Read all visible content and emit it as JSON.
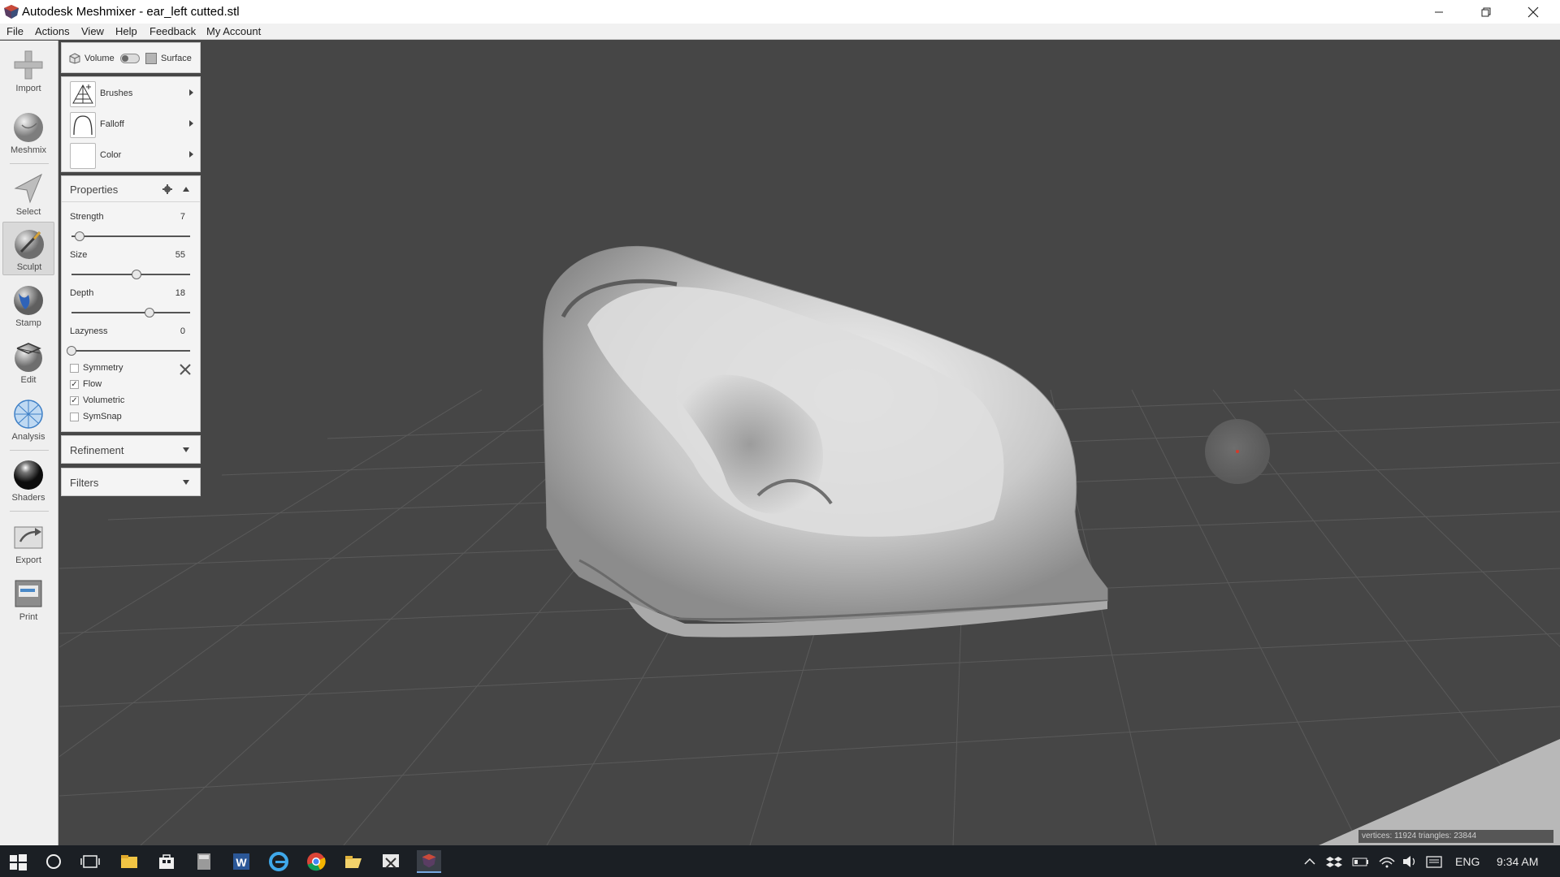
{
  "window": {
    "title": "Autodesk Meshmixer - ear_left cutted.stl"
  },
  "menu": [
    "File",
    "Actions",
    "View",
    "Help",
    "Feedback",
    "My Account"
  ],
  "tools": [
    {
      "label": "Import",
      "icon": "plus-icon"
    },
    {
      "label": "Meshmix",
      "icon": "meshmix-icon"
    },
    {
      "label": "Select",
      "icon": "select-arrow-icon"
    },
    {
      "label": "Sculpt",
      "icon": "sculpt-brush-icon",
      "active": true
    },
    {
      "label": "Stamp",
      "icon": "stamp-icon"
    },
    {
      "label": "Edit",
      "icon": "edit-icon"
    },
    {
      "label": "Analysis",
      "icon": "analysis-icon"
    },
    {
      "label": "Shaders",
      "icon": "shader-sphere-icon"
    },
    {
      "label": "Export",
      "icon": "export-icon"
    },
    {
      "label": "Print",
      "icon": "printer-icon"
    }
  ],
  "mode": {
    "volume_label": "Volume",
    "surface_label": "Surface"
  },
  "brush_panel": {
    "brushes_label": "Brushes",
    "falloff_label": "Falloff",
    "color_label": "Color"
  },
  "properties": {
    "title": "Properties",
    "strength": {
      "label": "Strength",
      "value": "7",
      "fraction": 0.07
    },
    "size": {
      "label": "Size",
      "value": "55",
      "fraction": 0.55
    },
    "depth": {
      "label": "Depth",
      "value": "18",
      "fraction": 0.66
    },
    "lazyness": {
      "label": "Lazyness",
      "value": "0",
      "fraction": 0.0
    },
    "symmetry": {
      "label": "Symmetry",
      "checked": false
    },
    "flow": {
      "label": "Flow",
      "checked": true
    },
    "volumetric": {
      "label": "Volumetric",
      "checked": true
    },
    "symsnap": {
      "label": "SymSnap",
      "checked": false
    }
  },
  "refinement": {
    "title": "Refinement"
  },
  "filters": {
    "title": "Filters"
  },
  "status": {
    "text": "vertices: 11924 triangles: 23844"
  },
  "taskbar": {
    "lang": "ENG",
    "time": "9:34 AM"
  },
  "colors": {
    "background": "#464646",
    "mesh": "#d4d4d4",
    "accent": "#78a8e0"
  }
}
